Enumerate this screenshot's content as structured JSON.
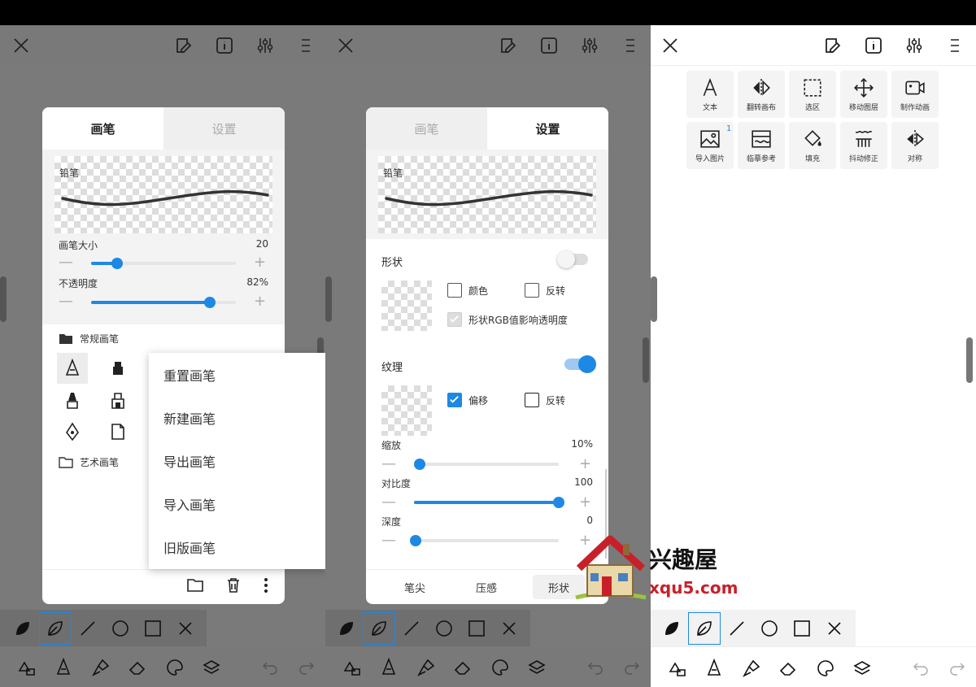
{
  "colors": {
    "accent": "#1e88e5",
    "dim_bg": "#7a7a7a"
  },
  "icons": {
    "close": "close-icon",
    "layers_edit": "canvas-edit-icon",
    "info": "info-icon",
    "adjust": "sliders-icon",
    "menu": "menu-icon"
  },
  "panel1": {
    "tabs": [
      "画笔",
      "设置"
    ],
    "brush_name": "铅笔",
    "size_label": "画笔大小",
    "size_value": "20",
    "size_fraction": 0.18,
    "opacity_label": "不透明度",
    "opacity_value": "82%",
    "opacity_fraction": 0.82,
    "folder_regular": "常规画笔",
    "folder_art": "艺术画笔",
    "context_menu": [
      "重置画笔",
      "新建画笔",
      "导出画笔",
      "导入画笔",
      "旧版画笔"
    ]
  },
  "panel2": {
    "tabs": [
      "画笔",
      "设置"
    ],
    "brush_name": "铅笔",
    "shape_label": "形状",
    "shape_color": "颜色",
    "shape_invert": "反转",
    "shape_rgb": "形状RGB值影响透明度",
    "texture_label": "纹理",
    "texture_offset": "偏移",
    "texture_invert": "反转",
    "scale_label": "缩放",
    "scale_value": "10%",
    "scale_fraction": 0.02,
    "contrast_label": "对比度",
    "contrast_value": "100",
    "contrast_fraction": 1.0,
    "depth_label": "深度",
    "depth_value": "0",
    "depth_fraction": 0.0,
    "subtabs": [
      "笔尖",
      "压感",
      "形状"
    ]
  },
  "panel3": {
    "tools": [
      "文本",
      "翻转画布",
      "选区",
      "移动图层",
      "制作动画",
      "导入图片",
      "临摹参考",
      "填充",
      "抖动修正",
      "对称"
    ],
    "import_badge": "1"
  },
  "watermark": {
    "name": "兴趣屋",
    "url": "xqu5.com"
  }
}
